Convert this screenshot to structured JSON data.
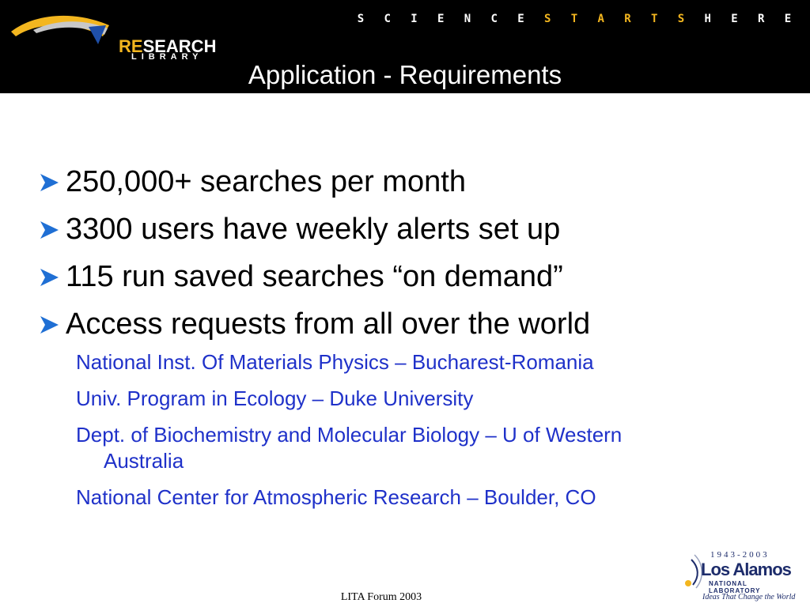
{
  "header": {
    "logo": {
      "re": "RE",
      "search": "SEARCH",
      "library": "LIBRARY",
      "name": "RESEARCH LIBRARY"
    },
    "tagline": {
      "part1": [
        "S",
        "C",
        "I",
        "E",
        "N",
        "C",
        "E"
      ],
      "part2": [
        "S",
        "T",
        "A",
        "R",
        "T",
        "S"
      ],
      "part3": [
        "H",
        "E",
        "R",
        "E"
      ]
    },
    "colors": {
      "background": "#000000",
      "accent": "#f3b61f",
      "text": "#ffffff"
    }
  },
  "slide": {
    "title": "Application - Requirements",
    "bullets": [
      "250,000+ searches per month",
      "3300 users have weekly alerts set up",
      "115 run saved searches “on demand”",
      "Access requests from all over the world"
    ],
    "sub_items": [
      "National Inst. Of Materials Physics – Bucharest-Romania",
      "Univ. Program in Ecology – Duke University",
      "Dept. of Biochemistry and Molecular Biology – U of Western Australia",
      "National Center for Atmospheric Research – Boulder, CO"
    ],
    "colors": {
      "bullet_arrow": "#1f6fd4",
      "sub_text": "#1f31c9"
    }
  },
  "branding": {
    "years": "1943-2003",
    "name": "Los Alamos",
    "subtitle": "NATIONAL LABORATORY",
    "slogan": "Ideas That Change the World"
  },
  "footer": {
    "text": "LITA Forum 2003"
  }
}
